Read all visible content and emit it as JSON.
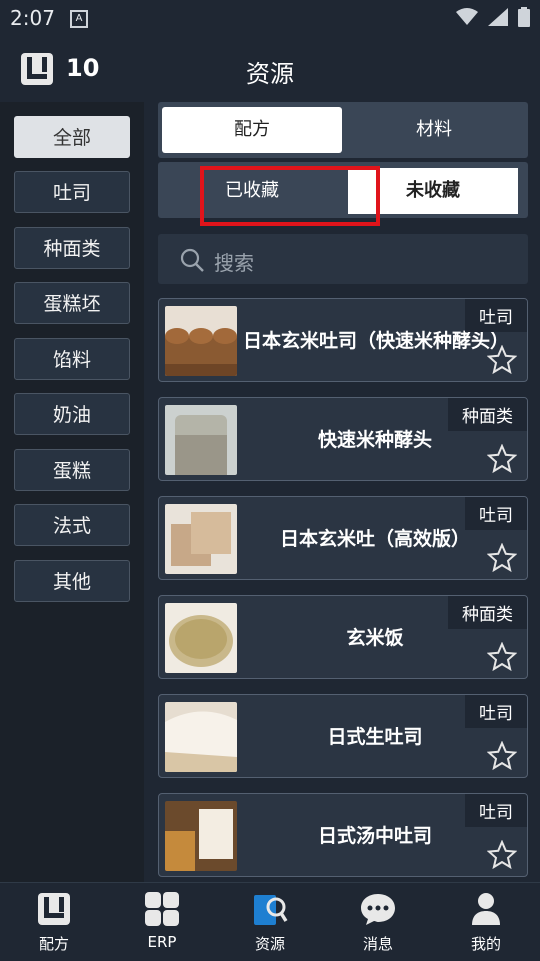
{
  "status_bar": {
    "time": "2:07",
    "notification_icon": "A"
  },
  "header": {
    "count": "10",
    "title": "资源"
  },
  "sidebar": {
    "items": [
      "全部",
      "吐司",
      "种面类",
      "蛋糕坯",
      "馅料",
      "奶油",
      "蛋糕",
      "法式",
      "其他"
    ],
    "active": "全部"
  },
  "segment_type": {
    "options": [
      "配方",
      "材料"
    ],
    "selected": "配方"
  },
  "segment_fav": {
    "options": [
      "已收藏",
      "未收藏"
    ],
    "selected": "未收藏"
  },
  "search": {
    "placeholder": "搜索"
  },
  "recipes": [
    {
      "name": "日本玄米吐司（快速米种酵头）",
      "tag": "吐司",
      "thumb": "bread-loaves"
    },
    {
      "name": "快速米种酵头",
      "tag": "种面类",
      "thumb": "starter-jar"
    },
    {
      "name": "日本玄米吐（高效版）",
      "tag": "吐司",
      "thumb": "sliced-bread"
    },
    {
      "name": "玄米饭",
      "tag": "种面类",
      "thumb": "rice-bowl"
    },
    {
      "name": "日式生吐司",
      "tag": "吐司",
      "thumb": "soft-bread"
    },
    {
      "name": "日式汤中吐司",
      "tag": "吐司",
      "thumb": "bread-jar"
    }
  ],
  "tabbar": {
    "items": [
      "配方",
      "ERP",
      "资源",
      "消息",
      "我的"
    ],
    "active": "资源"
  },
  "colors": {
    "highlight_box": "#e0141b",
    "background": "#1f2733",
    "card": "#2b3543"
  }
}
